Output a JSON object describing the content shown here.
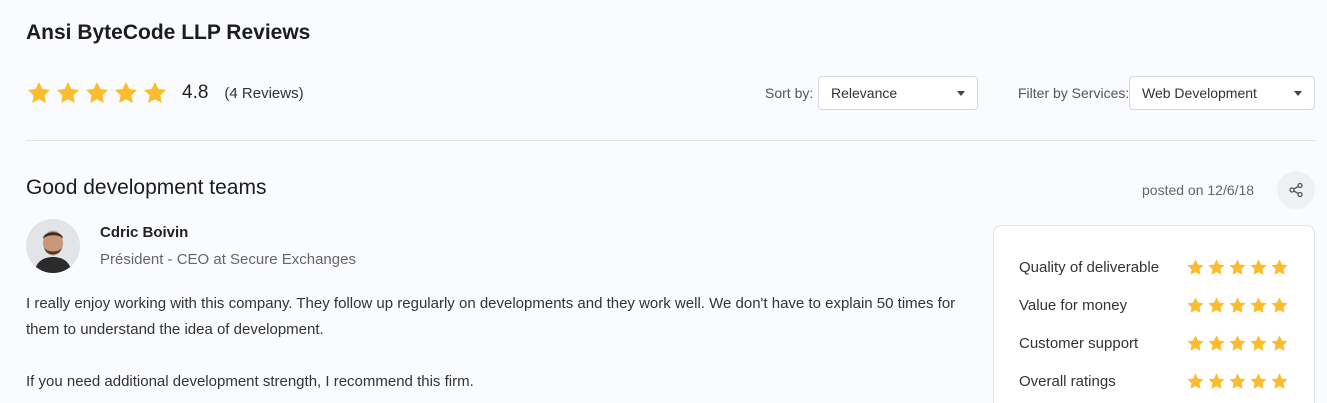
{
  "page": {
    "title": "Ansi ByteCode LLP Reviews"
  },
  "summary": {
    "star_rating": 5,
    "score": "4.8",
    "count": "(4 Reviews)"
  },
  "sort": {
    "label": "Sort by:",
    "selected": "Relevance"
  },
  "filter": {
    "label": "Filter by Services:",
    "selected": "Web Development"
  },
  "review": {
    "title": "Good development teams",
    "posted": "posted on 12/6/18",
    "reviewer_name": "Cdric Boivin",
    "reviewer_role": "Président - CEO at Secure Exchanges",
    "body_1": "I really enjoy working with this company. They follow up regularly on developments and they work well. We don't have to explain 50 times for them to understand the idea of development.",
    "body_2": "If you need additional development strength, I recommend this firm.",
    "ratings": [
      {
        "label": "Quality of deliverable",
        "stars": 5
      },
      {
        "label": "Value for money",
        "stars": 5
      },
      {
        "label": "Customer support",
        "stars": 5
      },
      {
        "label": "Overall ratings",
        "stars": 5
      }
    ]
  },
  "icons": {
    "star": "star-icon",
    "share": "share-icon",
    "caret": "chevron-down-icon"
  },
  "colors": {
    "star": "#fbbc2e",
    "background": "#fafbfe"
  }
}
